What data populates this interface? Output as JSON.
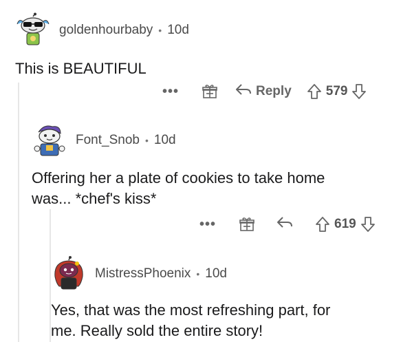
{
  "comments": [
    {
      "username": "goldenhourbaby",
      "separator": "•",
      "time": "10d",
      "body_lines": [
        "This is BEAUTIFUL"
      ],
      "reply_label": "Reply",
      "score": "579",
      "more_label": "•••",
      "icons": {
        "more": "more-options-icon",
        "award": "gift-award-icon",
        "reply": "reply-arrow-icon",
        "upvote": "upvote-arrow-icon",
        "downvote": "downvote-arrow-icon"
      }
    },
    {
      "username": "Font_Snob",
      "separator": "•",
      "time": "10d",
      "body_lines": [
        "Offering her a plate of cookies to take home",
        "was... *chef's kiss*"
      ],
      "reply_label": "",
      "score": "619",
      "more_label": "•••",
      "icons": {
        "more": "more-options-icon",
        "award": "gift-award-icon",
        "reply": "reply-arrow-icon",
        "upvote": "upvote-arrow-icon",
        "downvote": "downvote-arrow-icon"
      }
    },
    {
      "username": "MistressPhoenix",
      "separator": "•",
      "time": "10d",
      "body_lines": [
        "Yes, that was the most refreshing part, for",
        "me.  Really sold the entire story!"
      ]
    }
  ],
  "colors": {
    "text": "#1a1a1b",
    "meta": "#4a4a4a",
    "icon": "#666666",
    "thread_line": "#e6e6e6"
  }
}
